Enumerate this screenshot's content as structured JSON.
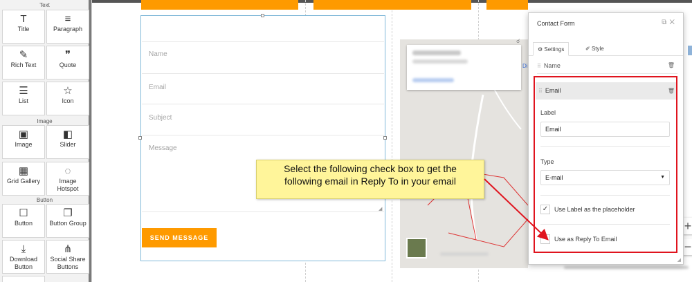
{
  "sidebar": {
    "sections": [
      "Text",
      "Image",
      "Button"
    ],
    "tiles": [
      {
        "label": "Title",
        "icon": "T"
      },
      {
        "label": "Paragraph",
        "icon": "≡"
      },
      {
        "label": "Rich Text",
        "icon": "✎"
      },
      {
        "label": "Quote",
        "icon": "❞"
      },
      {
        "label": "List",
        "icon": "☰"
      },
      {
        "label": "Icon",
        "icon": "☆"
      },
      {
        "label": "Image",
        "icon": "▣"
      },
      {
        "label": "Slider",
        "icon": "◧"
      },
      {
        "label": "Grid Gallery",
        "icon": "▦"
      },
      {
        "label": "Image Hotspot",
        "icon": "◌"
      },
      {
        "label": "Button",
        "icon": "☐"
      },
      {
        "label": "Button Group",
        "icon": "❐"
      },
      {
        "label": "Download Button",
        "icon": "⤓"
      },
      {
        "label": "Social Share Buttons",
        "icon": "⋔"
      }
    ]
  },
  "form": {
    "placeholders": {
      "name": "Name",
      "email": "Email",
      "subject": "Subject",
      "message": "Message"
    },
    "send_label": "SEND MESSAGE"
  },
  "map": {
    "link_partial": "Di"
  },
  "dialog": {
    "title": "Contact Form",
    "tabs": {
      "settings": "Settings",
      "style": "Style"
    },
    "fields": {
      "name": "Name",
      "email": "Email"
    },
    "label_caption": "Label",
    "label_value": "Email",
    "type_caption": "Type",
    "type_value": "E-mail",
    "checkbox_placeholder": "Use Label as the placeholder",
    "checkbox_placeholder_checked": true,
    "checkbox_reply": "Use as Reply To Email",
    "checkbox_reply_checked": false
  },
  "callout": {
    "line1": "Select the following check box to get the",
    "line2": "following email in Reply To in your email"
  },
  "zoom": {
    "plus": "+",
    "minus": "−"
  },
  "colors": {
    "accent": "#fe9a00",
    "highlight": "#e0141e",
    "callout": "#fff59a",
    "selection": "#7fb8d8"
  }
}
